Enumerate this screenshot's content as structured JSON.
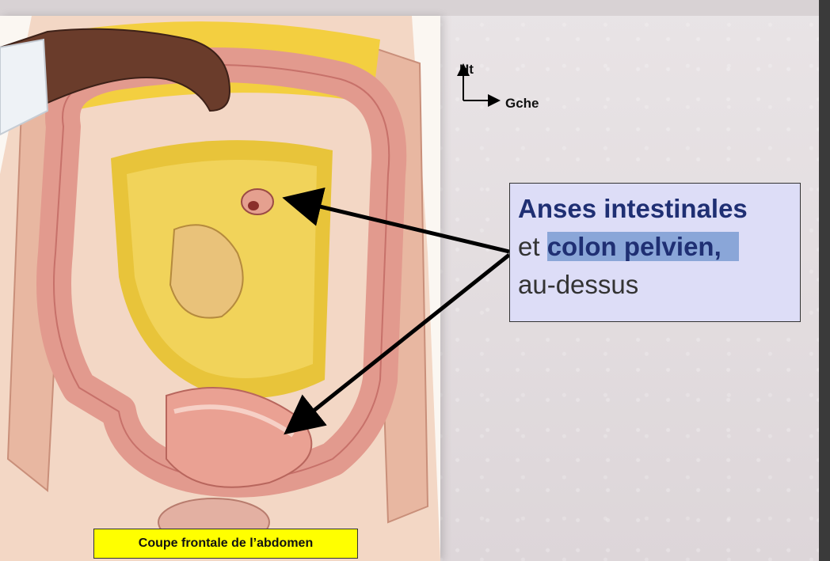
{
  "caption": "Coupe frontale de l’abdomen",
  "axes": {
    "up_label": "Ht",
    "left_label": "Gche"
  },
  "label_box": {
    "line1": "Anses intestinales",
    "line2_prefix": "et ",
    "line2_highlight": "colon pelvien,",
    "line3": "au-dessus"
  },
  "colors": {
    "caption_bg": "#ffff00",
    "label_box_bg": "#ddddf7",
    "label_title": "#1f2f73",
    "highlight": "#8aa6d8"
  }
}
